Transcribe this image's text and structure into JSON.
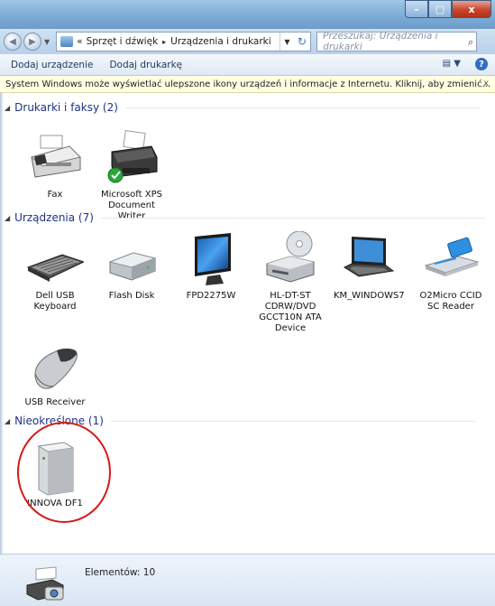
{
  "window": {
    "minimize": "–",
    "maximize": "□",
    "close": "x"
  },
  "address": {
    "path_root": "«",
    "crumb1": "Sprzęt i dźwięk",
    "crumb_sep": "▸",
    "crumb2": "Urządzenia i drukarki"
  },
  "search": {
    "placeholder": "Przeszukaj: Urządzenia i drukarki"
  },
  "toolbar": {
    "add_device": "Dodaj urządzenie",
    "add_printer": "Dodaj drukarkę"
  },
  "infobar": {
    "text": "System Windows może wyświetlać ulepszone ikony urządzeń i informacje z Internetu. Kliknij, aby zmienić...",
    "close": "x"
  },
  "groups": {
    "printers": {
      "title": "Drukarki i faksy (2)",
      "items": [
        {
          "label": "Fax",
          "icon": "fax-icon"
        },
        {
          "label": "Microsoft XPS Document Writer",
          "icon": "printer-icon"
        }
      ]
    },
    "devices": {
      "title": "Urządzenia (7)",
      "items": [
        {
          "label": "Dell USB Keyboard",
          "icon": "keyboard-icon"
        },
        {
          "label": "Flash Disk",
          "icon": "flash-disk-icon"
        },
        {
          "label": "FPD2275W",
          "icon": "monitor-icon"
        },
        {
          "label": "HL-DT-ST CDRW/DVD GCCT10N ATA Device",
          "icon": "cd-drive-icon"
        },
        {
          "label": "KM_WINDOWS7",
          "icon": "laptop-icon"
        },
        {
          "label": "O2Micro CCID SC Reader",
          "icon": "card-reader-icon"
        },
        {
          "label": "USB Receiver",
          "icon": "mouse-icon"
        }
      ]
    },
    "unspecified": {
      "title": "Nieokreślone (1)",
      "items": [
        {
          "label": "INNOVA DF1",
          "icon": "server-box-icon"
        }
      ]
    }
  },
  "status": {
    "text": "Elementów: 10"
  },
  "colors": {
    "group_header": "#1e3287",
    "annotation": "#d51a1a",
    "infobar_bg": "#ffffe1"
  }
}
